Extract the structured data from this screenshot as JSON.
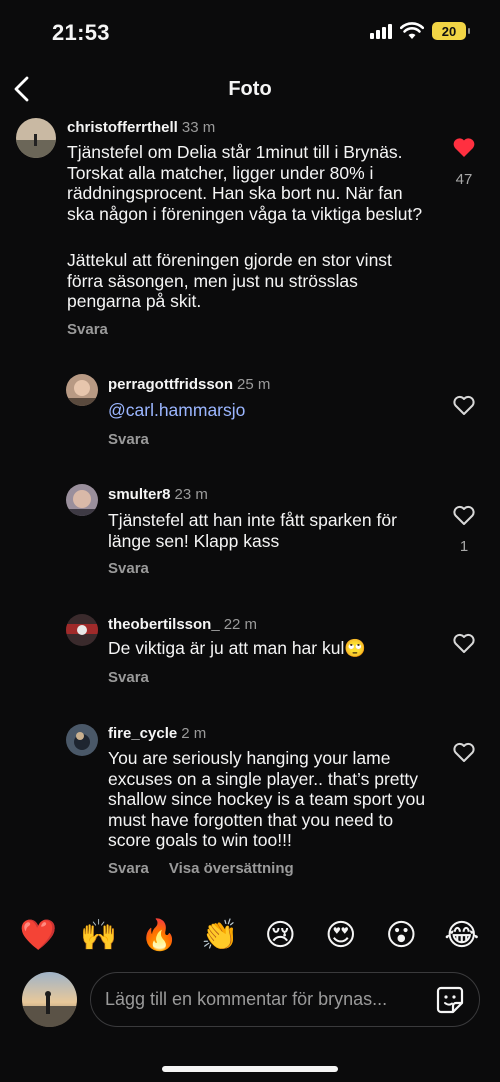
{
  "status_bar": {
    "time": "21:53",
    "battery": "20"
  },
  "header": {
    "title": "Foto"
  },
  "main_comment": {
    "username": "christofferrthell",
    "time": "33 m",
    "text_p1": "Tjänstefel om Delia står 1minut till i Brynäs. Torskat alla matcher, ligger under 80% i räddningsprocent. Han ska bort nu. När fan ska någon i föreningen våga ta viktiga beslut?",
    "text_p2": "Jättekul att föreningen gjorde en stor vinst förra säsongen, men just nu strösslas pengarna på skit.",
    "reply_label": "Svara",
    "like_count": "47",
    "liked": true
  },
  "replies": [
    {
      "username": "perragottfridsson",
      "time": "25 m",
      "text": "@carl.hammarsjo",
      "reply_label": "Svara",
      "like_count": ""
    },
    {
      "username": "smulter8",
      "time": "23 m",
      "text": "Tjänstefel att han inte fått sparken för länge sen! Klapp kass",
      "reply_label": "Svara",
      "like_count": "1"
    },
    {
      "username": "theobertilsson_",
      "time": "22 m",
      "text": "De viktiga är ju att man har kul🙄",
      "reply_label": "Svara",
      "like_count": ""
    },
    {
      "username": "fire_cycle",
      "time": "2 m",
      "text": "You are seriously hanging your lame excuses on a single player.. that’s pretty shallow since hockey is a team sport you must have forgotten that you need to score goals to win too!!!",
      "reply_label": "Svara",
      "translate_label": "Visa översättning",
      "like_count": ""
    }
  ],
  "emoji_bar": [
    "❤️",
    "🙌",
    "🔥",
    "👏",
    "😢",
    "😍",
    "😮",
    "😂"
  ],
  "composer": {
    "placeholder": "Lägg till en kommentar för brynas..."
  },
  "colors": {
    "background": "#0b0b0c",
    "like_red": "#ff3040",
    "mention": "#9bb6ff",
    "muted": "#9a9a9a"
  }
}
